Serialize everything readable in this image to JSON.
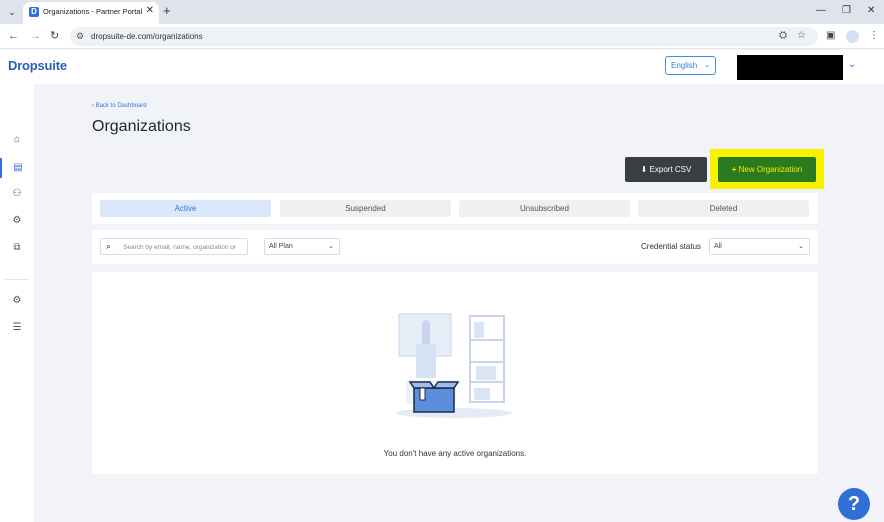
{
  "browser": {
    "tab_title": "Organizations - Partner Portal",
    "url": "dropsuite-de.com/organizations"
  },
  "header": {
    "logo_text": "Dropsuite",
    "language": "English"
  },
  "sidebar": {
    "items": [
      {
        "icon": "home-icon"
      },
      {
        "icon": "organizations-icon",
        "active": true
      },
      {
        "icon": "users-icon"
      },
      {
        "icon": "settings-gear-icon"
      },
      {
        "icon": "copy-icon"
      },
      {
        "icon": "cog-icon"
      },
      {
        "icon": "server-icon"
      }
    ]
  },
  "page": {
    "back_link": "‹ Back to Dashboard",
    "title": "Organizations",
    "export_label": "Export CSV",
    "new_org_label": "New Organization"
  },
  "status_tabs": [
    "Active",
    "Suspended",
    "Unsubscribed",
    "Deleted"
  ],
  "filters": {
    "search_placeholder": "Search by email, name, organization or",
    "plan_value": "All Plan",
    "credential_label": "Credential status",
    "credential_value": "All"
  },
  "empty_state": {
    "message": "You don't have any active organizations."
  },
  "help": {
    "label": "?"
  },
  "colors": {
    "accent": "#2f6fd8",
    "new_org_bg": "#2b7a1f",
    "highlight": "#f6f200",
    "export_bg": "#3a3d43"
  }
}
